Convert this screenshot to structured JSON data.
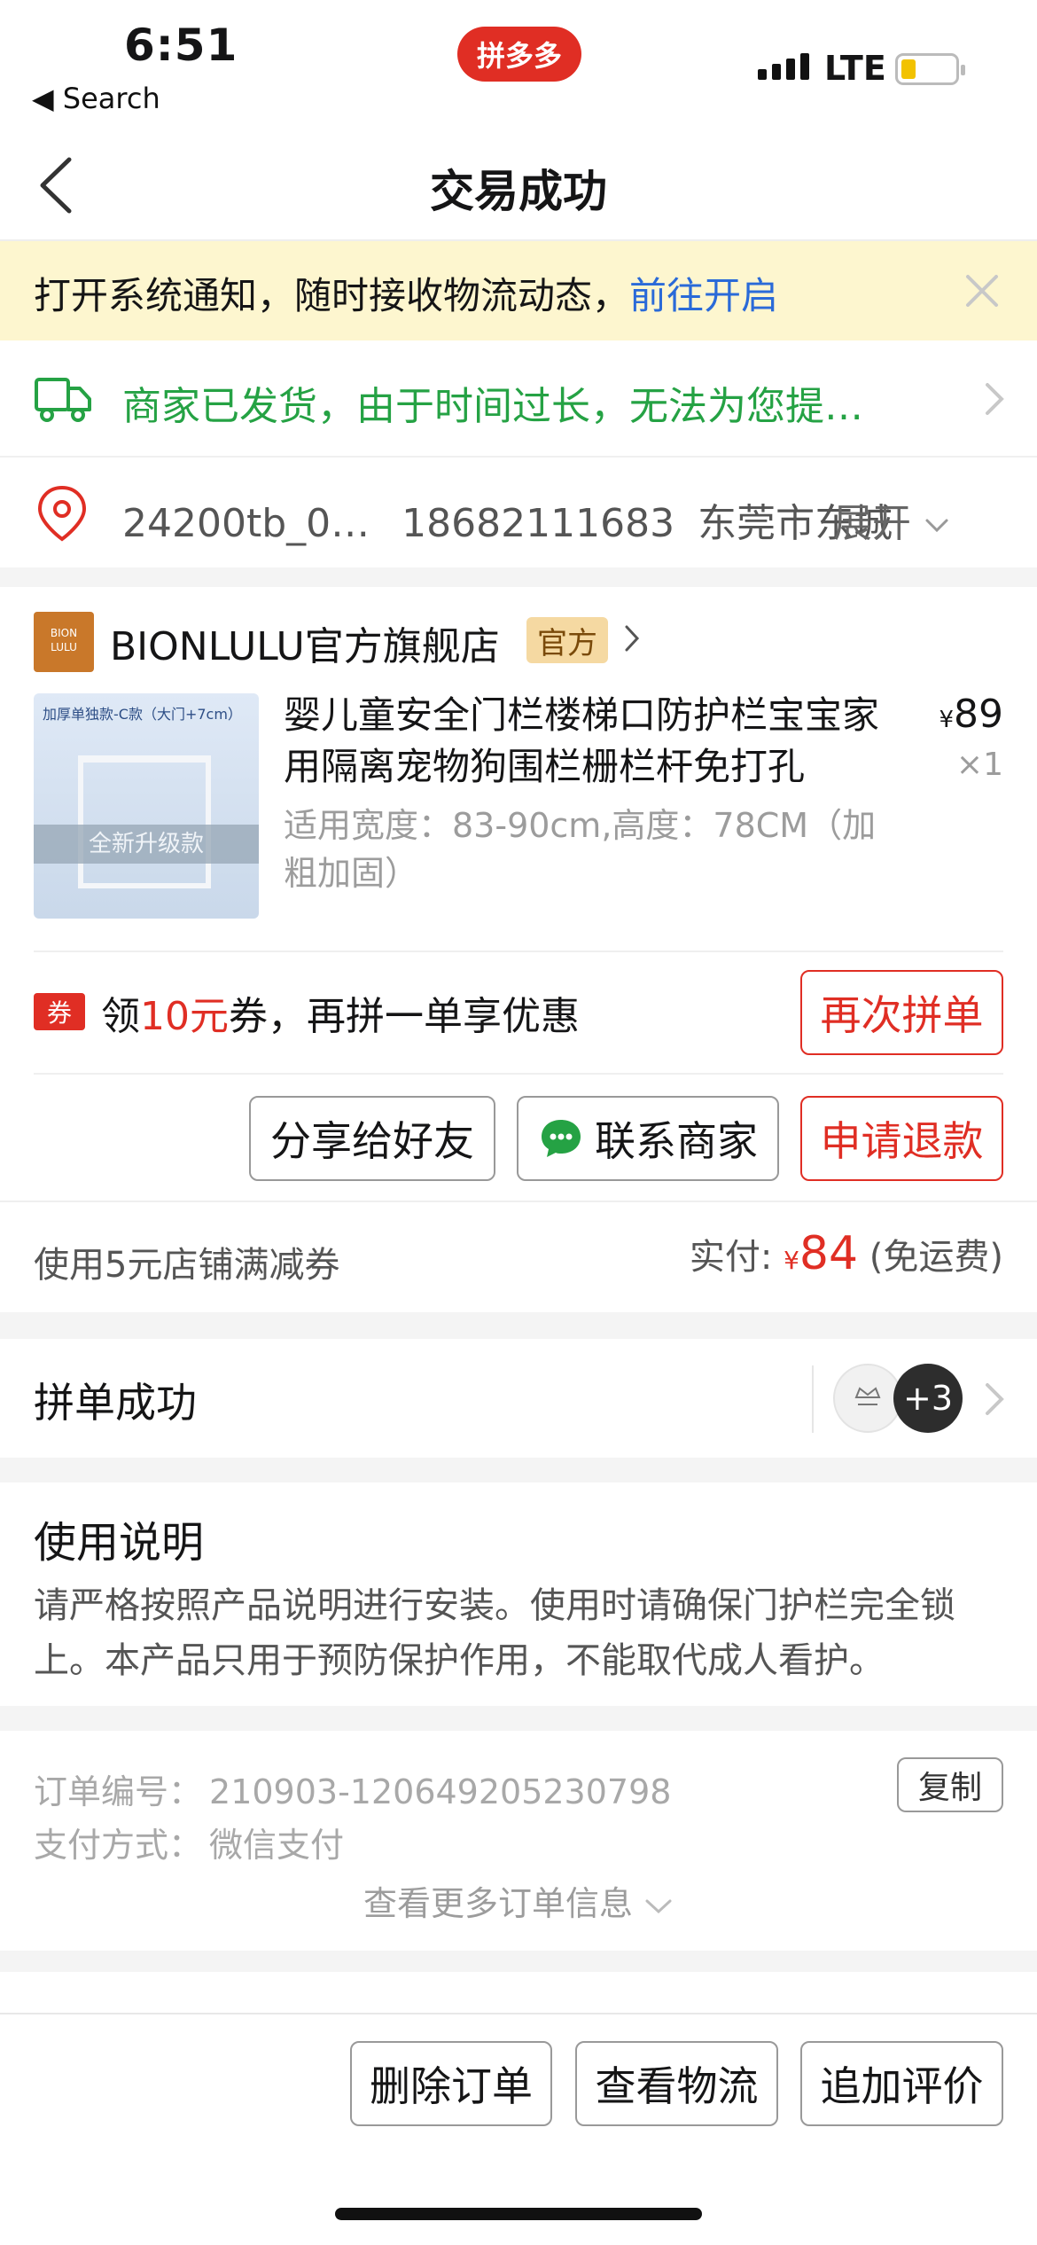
{
  "status_bar": {
    "time": "6:51",
    "back_label": "◀ Search",
    "app_badge": "拼多多",
    "network": "LTE"
  },
  "nav": {
    "title": "交易成功"
  },
  "notice": {
    "text": "打开系统通知，随时接收物流动态，",
    "link": "前往开启"
  },
  "shipping": {
    "status_text": "商家已发货，由于时间过长，无法为您提…"
  },
  "address": {
    "name": "24200tb_0…",
    "phone": "18682111683",
    "location": "东莞市东城",
    "expand_label": "展开"
  },
  "store": {
    "logo_text_1": "BION",
    "logo_text_2": "LULU",
    "name": "BIONLULU官方旗舰店",
    "tag": "官方"
  },
  "product": {
    "title": "婴儿童安全门栏楼梯口防护栏宝宝家用隔离宠物狗围栏栅栏杆免打孔",
    "spec": "适用宽度：83-90cm,高度：78CM（加粗加固）",
    "price_symbol": "¥",
    "price": "89",
    "quantity": "×1",
    "image_caption": "加厚单独款-C款（大门+7cm）",
    "image_banner": "全新升级款"
  },
  "coupon": {
    "badge": "券",
    "prefix": "领",
    "amount": "10元",
    "suffix": "券，再拼一单享优惠",
    "button": "再次拼单"
  },
  "actions": {
    "share": "分享给好友",
    "contact": "联系商家",
    "refund": "申请退款"
  },
  "payment": {
    "discount_note": "使用5元店铺满减券",
    "paid_label": "实付:",
    "currency": "¥",
    "amount": "84",
    "shipping_note": "(免运费)"
  },
  "group": {
    "title": "拼单成功",
    "more_count": "+3"
  },
  "usage": {
    "title": "使用说明",
    "body": "请严格按照产品说明进行安装。使用时请确保门护栏完全锁上。本产品只用于预防保护作用，不能取代成人看护。"
  },
  "order_info": {
    "order_no_label": "订单编号：",
    "order_no": "210903-120649205230798",
    "copy_button": "复制",
    "pay_method_label": "支付方式：",
    "pay_method": "微信支付",
    "more_label": "查看更多订单信息"
  },
  "bottom_actions": {
    "delete": "删除订单",
    "logistics": "查看物流",
    "review": "追加评价"
  },
  "colors": {
    "brand_red": "#e02e24",
    "ship_green": "#25a244",
    "link_blue": "#2a6ad8",
    "notice_bg": "#fdf6cf"
  }
}
